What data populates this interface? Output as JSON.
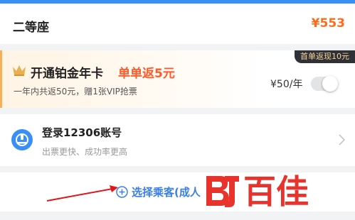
{
  "seat": {
    "name": "二等座",
    "price": "¥553"
  },
  "promo": {
    "title": "开通铂金年卡",
    "highlight": "单单返5元",
    "subtitle": "一年内共返50元，赠1张VIP抢票",
    "badge": "首单返现10元",
    "price": "¥50/年",
    "toggle_on": false
  },
  "login": {
    "title": "登录12306账号",
    "subtitle": "出票更快、成功率更高"
  },
  "passenger": {
    "label": "选择乘客(成人"
  },
  "watermark": {
    "text": "百佳"
  },
  "colors": {
    "accent_blue": "#3a7fe8",
    "price_orange": "#ff6a1a",
    "promo_red": "#ff5a2a",
    "arrow_red": "#e0161b",
    "watermark_red": "#e8322c"
  },
  "icons": [
    "crown-icon",
    "railway-logo-icon",
    "chevron-right-icon",
    "plus-circle-icon"
  ]
}
